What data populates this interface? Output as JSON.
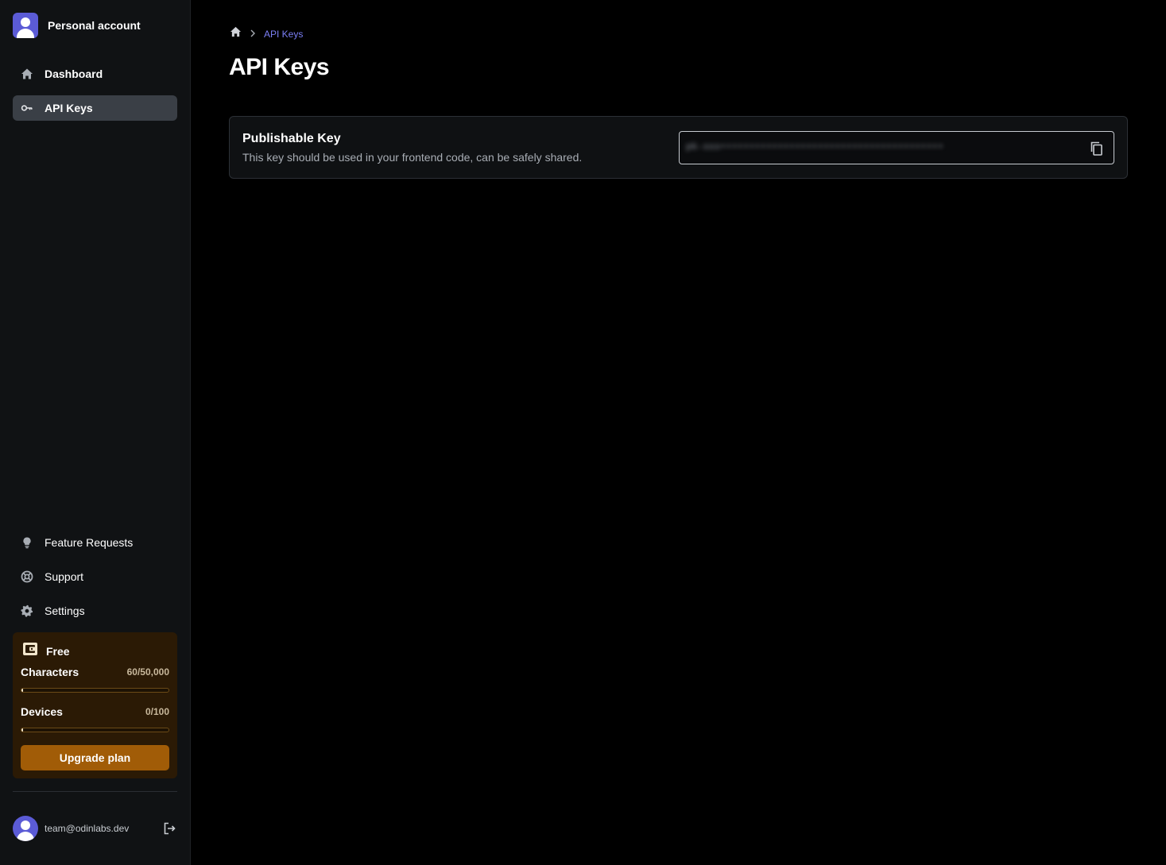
{
  "sidebar": {
    "account_label": "Personal account",
    "nav_top": [
      {
        "label": "Dashboard",
        "icon": "home-icon"
      },
      {
        "label": "API Keys",
        "icon": "key-icon",
        "active": true
      }
    ],
    "nav_bottom": [
      {
        "label": "Feature Requests",
        "icon": "lightbulb-icon"
      },
      {
        "label": "Support",
        "icon": "lifebuoy-icon"
      },
      {
        "label": "Settings",
        "icon": "gear-icon"
      }
    ],
    "plan": {
      "name": "Free",
      "meters": [
        {
          "label": "Characters",
          "value": "60/50,000",
          "fraction": 0.0012
        },
        {
          "label": "Devices",
          "value": "0/100",
          "fraction": 0
        }
      ],
      "upgrade_label": "Upgrade plan"
    },
    "user": {
      "email": "team@odinlabs.dev"
    }
  },
  "main": {
    "breadcrumb": {
      "current": "API Keys"
    },
    "title": "API Keys",
    "card": {
      "title": "Publishable Key",
      "description": "This key should be used in your frontend code, can be safely shared.",
      "key_value": "pk-xxx•••••••••••••••••••••••••••••••••••••••"
    }
  },
  "colors": {
    "accent": "#7b7ff6",
    "plan_bg": "#2b1a05",
    "upgrade_button": "#a15c07",
    "active_nav": "#3a3f46"
  }
}
